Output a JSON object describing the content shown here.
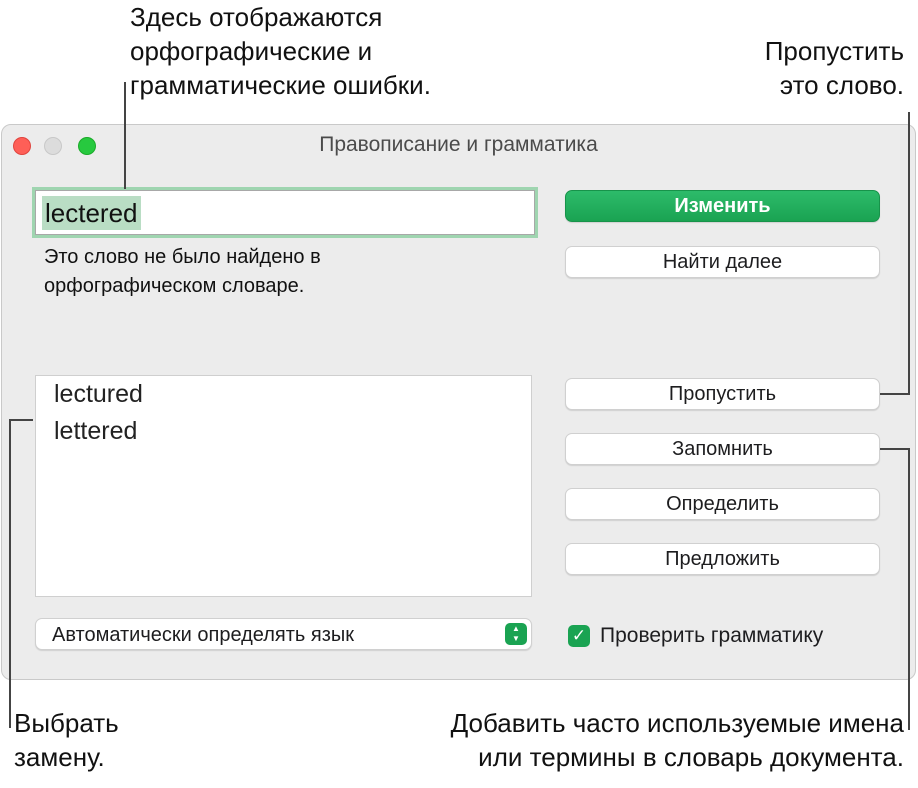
{
  "callouts": {
    "errors": [
      "Здесь отображаются",
      "орфографические и",
      "грамматические ошибки."
    ],
    "skip": [
      "Пропустить",
      "это слово."
    ],
    "replace": [
      "Выбрать",
      "замену."
    ],
    "learn": [
      "Добавить часто используемые имена",
      "или термины в словарь документа."
    ]
  },
  "window": {
    "title": "Правописание и грамматика",
    "misspelled_word": "lectered",
    "message_lines": [
      "Это слово не было найдено в",
      "орфографическом словаре."
    ],
    "buttons": {
      "change": "Изменить",
      "find_next": "Найти далее",
      "ignore": "Пропустить",
      "learn": "Запомнить",
      "define": "Определить",
      "guess": "Предложить"
    },
    "suggestions": [
      "lectured",
      "lettered"
    ],
    "language_select": {
      "selected": "Автоматически определять язык"
    },
    "check_grammar": {
      "label": "Проверить грамматику",
      "checked": true
    }
  },
  "colors": {
    "accent": "#1aa352",
    "highlight": "#b9ddc4"
  },
  "icons": {
    "stepper": "chevron-updown-icon",
    "checkmark": "checkmark-icon"
  }
}
